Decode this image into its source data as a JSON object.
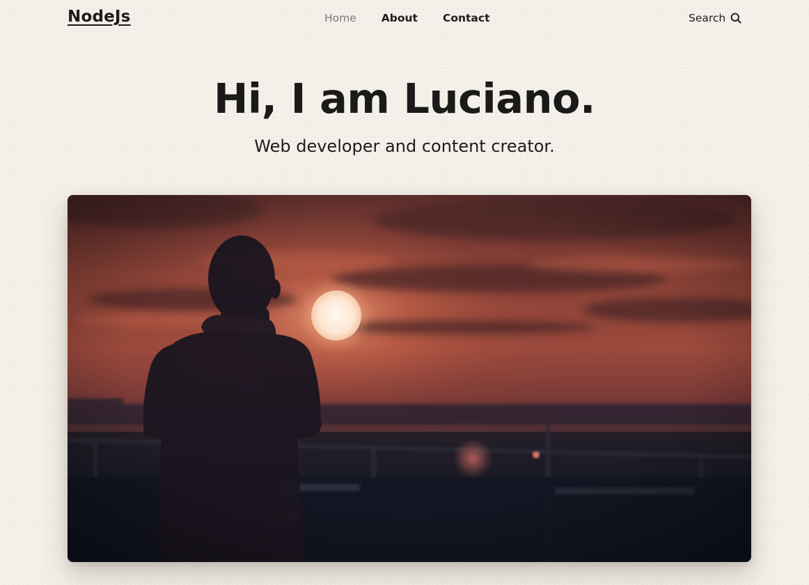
{
  "header": {
    "logo": "NodeJs",
    "nav": [
      {
        "label": "Home",
        "active": true
      },
      {
        "label": "About",
        "active": false
      },
      {
        "label": "Contact",
        "active": false
      }
    ],
    "search_label": "Search",
    "search_icon": "search-icon"
  },
  "hero": {
    "title": "Hi, I am Luciano.",
    "subtitle": "Web developer and content creator.",
    "image_subject": "person silhouette against sunset"
  },
  "colors": {
    "background": "#f5f1ea",
    "text": "#1c1c1c",
    "nav_active": "#7a7a7a",
    "sunset_glow": "#b4553f",
    "sky_dark": "#2a1f2a"
  }
}
